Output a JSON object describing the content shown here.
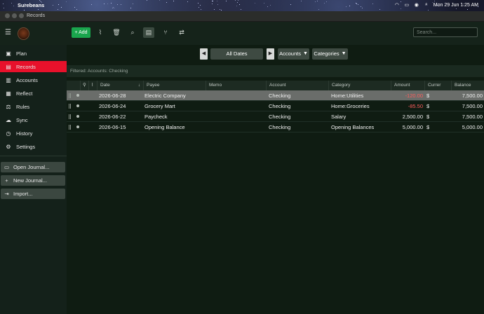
{
  "menubar": {
    "app_name": "Surebeans",
    "clock": "Mon 29 Jun  1:25 AM",
    "icons": [
      "wifi-icon",
      "battery-icon",
      "control-center-icon",
      "search-icon"
    ]
  },
  "window": {
    "title": "Records"
  },
  "toolbar": {
    "add_label": "+ Add",
    "search_placeholder": "Search...",
    "icons": [
      "paperclip-icon",
      "trash-icon",
      "find-icon",
      "journal-icon",
      "split-icon",
      "transfer-icon"
    ]
  },
  "sidebar": {
    "items": [
      {
        "label": "Plan",
        "icon": "plan-icon"
      },
      {
        "label": "Records",
        "icon": "records-icon",
        "active": true
      },
      {
        "label": "Accounts",
        "icon": "accounts-icon"
      },
      {
        "label": "Reflect",
        "icon": "reflect-icon"
      },
      {
        "label": "Rules",
        "icon": "rules-icon"
      },
      {
        "label": "Sync",
        "icon": "sync-icon"
      },
      {
        "label": "History",
        "icon": "history-icon"
      },
      {
        "label": "Settings",
        "icon": "settings-icon"
      }
    ],
    "buttons": [
      {
        "label": "Open Journal...",
        "icon": "folder-icon"
      },
      {
        "label": "New Journal...",
        "icon": "plus-icon"
      },
      {
        "label": "Import...",
        "icon": "import-icon"
      }
    ]
  },
  "filters": {
    "date_label": "All Dates",
    "accounts_label": "Accounts",
    "categories_label": "Categories",
    "filtered_text": "Filtered: Accounts: Checking"
  },
  "table": {
    "headers": {
      "date": "Date",
      "payee": "Payee",
      "memo": "Memo",
      "account": "Account",
      "category": "Category",
      "amount": "Amount",
      "currency": "Currer",
      "balance": "Balance"
    },
    "rows": [
      {
        "date": "2026-06-28",
        "payee": "Electric Company",
        "memo": "",
        "account": "Checking",
        "category": "Home:Utilities",
        "amount": "-120.00",
        "currency": "$",
        "balance": "7,500.00",
        "negative": true,
        "selected": true
      },
      {
        "date": "2026-06-24",
        "payee": "Grocery Mart",
        "memo": "",
        "account": "Checking",
        "category": "Home:Groceries",
        "amount": "-85.50",
        "currency": "$",
        "balance": "7,500.00",
        "negative": true
      },
      {
        "date": "2026-06-22",
        "payee": "Paycheck",
        "memo": "",
        "account": "Checking",
        "category": "Salary",
        "amount": "2,500.00",
        "currency": "$",
        "balance": "7,500.00",
        "negative": false
      },
      {
        "date": "2026-06-15",
        "payee": "Opening Balance",
        "memo": "",
        "account": "Checking",
        "category": "Opening Balances",
        "amount": "5,000.00",
        "currency": "$",
        "balance": "5,000.00",
        "negative": false
      }
    ]
  },
  "colors": {
    "accent_green": "#1aa54d",
    "active_red": "#e8112b",
    "negative_red": "#ff5d5d"
  }
}
